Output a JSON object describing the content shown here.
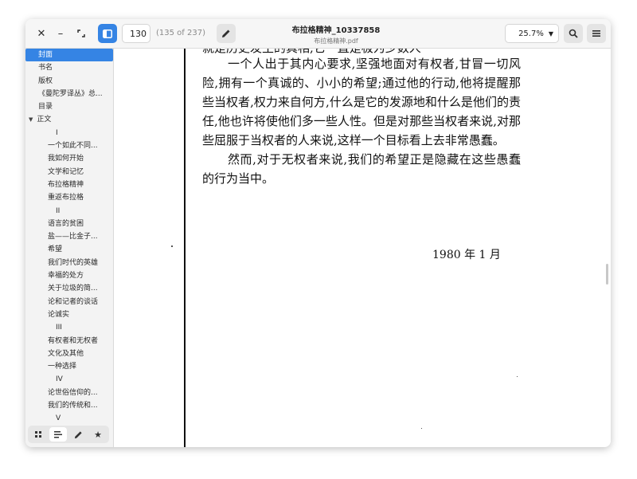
{
  "header": {
    "close_icon": "close-icon",
    "minimize_icon": "minimize-icon",
    "maximize_icon": "maximize-icon",
    "sidebar_toggle_icon": "sidebar-icon",
    "page_input_value": "130",
    "page_count": "(135 of 237)",
    "edit_icon": "pencil-icon",
    "title": "布拉格精神_10337858",
    "subtitle": "布拉格精神.pdf",
    "zoom_value": "25.7%",
    "search_icon": "search-icon",
    "menu_icon": "hamburger-menu-icon",
    "accent_color": "#3584e4"
  },
  "sidebar": {
    "toc": [
      {
        "label": "封面",
        "level": 0,
        "selected": true
      },
      {
        "label": "书名",
        "level": 0
      },
      {
        "label": "版权",
        "level": 0
      },
      {
        "label": "《曼陀罗译丛》总...",
        "level": 0
      },
      {
        "label": "目录",
        "level": 0
      },
      {
        "label": "正文",
        "level": 0,
        "expanded": true
      },
      {
        "label": "I",
        "level": 2
      },
      {
        "label": "一个如此不同...",
        "level": 1
      },
      {
        "label": "我如何开始",
        "level": 1
      },
      {
        "label": "文学和记忆",
        "level": 1
      },
      {
        "label": "布拉格精神",
        "level": 1
      },
      {
        "label": "重返布拉格",
        "level": 1
      },
      {
        "label": "II",
        "level": 2
      },
      {
        "label": "语言的贫困",
        "level": 1
      },
      {
        "label": "盐——比金子...",
        "level": 1
      },
      {
        "label": "希望",
        "level": 1
      },
      {
        "label": "我们时代的英雄",
        "level": 1
      },
      {
        "label": "幸福的处方",
        "level": 1
      },
      {
        "label": "关于垃圾的简...",
        "level": 1
      },
      {
        "label": "论和记者的谈话",
        "level": 1
      },
      {
        "label": "论诚实",
        "level": 1
      },
      {
        "label": "III",
        "level": 2
      },
      {
        "label": "有权者和无权者",
        "level": 1
      },
      {
        "label": "文化及其他",
        "level": 1
      },
      {
        "label": "一种选择",
        "level": 1
      },
      {
        "label": "IV",
        "level": 2
      },
      {
        "label": "论世俗信仰的...",
        "level": 1
      },
      {
        "label": "我们的传统和...",
        "level": 1
      },
      {
        "label": "V",
        "level": 2
      }
    ],
    "footer_icons": [
      "grid-icon",
      "outline-icon",
      "annotate-icon",
      "star-icon"
    ]
  },
  "document": {
    "clipped_top_line": "就是历史发生的真相,它一直是极为少数人",
    "paragraph1": "一个人出于其内心要求,坚强地面对有权者,甘冒一切风险,拥有一个真诚的、小小的希望;通过他的行动,他将提醒那些当权者,权力来自何方,什么是它的发源地和什么是他们的责任,他也许将使他们多一些人性。但是对那些当权者来说,对那些屈服于当权者的人来说,这样一个目标看上去非常愚蠢。",
    "paragraph2": "然而,对于无权者来说,我们的希望正是隐藏在这些愚蠢的行为当中。",
    "date": "1980 年 1 月"
  }
}
